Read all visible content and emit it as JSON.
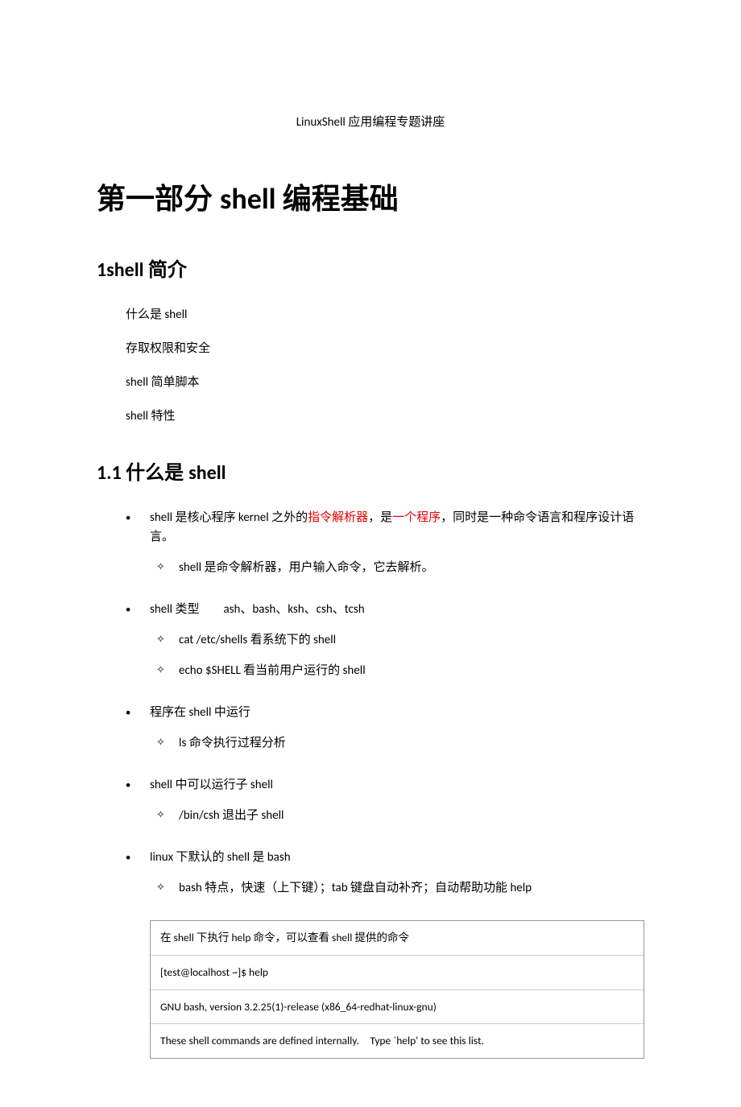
{
  "docTitle": "LinuxShell 应用编程专题讲座",
  "h1_pre": "第一部分 ",
  "h1_latin": "shell ",
  "h1_post": "编程基础",
  "section1": {
    "h2_pre": "1shell ",
    "h2_post": "简介",
    "items": [
      "什么是 shell",
      "存取权限和安全",
      "shell 简单脚本",
      "shell 特性"
    ]
  },
  "section11": {
    "h2_pre": "1.1 ",
    "h2_mid": "什么是 ",
    "h2_latin": "shell",
    "b0": {
      "t1": "shell 是核心程序 kernel 之外的",
      "r1": "指令解析器",
      "t2": "，是",
      "r2": "一个程序",
      "t3": "，同时是一种命令语言和程序设计语言。",
      "s1": "shell 是命令解析器，用户输入命令，它去解析。"
    },
    "b1": {
      "t": "shell 类型  ash、bash、ksh、csh、tcsh",
      "s1": "cat /etc/shells  看系统下的 shell",
      "s2": "echo $SHELL  看当前用户运行的 shell"
    },
    "b2": {
      "t": "程序在 shell 中运行",
      "s1": "ls 命令执行过程分析"
    },
    "b3": {
      "t": "shell 中可以运行子 shell",
      "s1": "/bin/csh  退出子 shell"
    },
    "b4": {
      "t": "linux 下默认的 shell 是 bash",
      "s1": "bash 特点，快速（上下键）；tab 键盘自动补齐；自动帮助功能 help"
    }
  },
  "codebox": {
    "r1": "在 shell 下执行 help 命令，可以查看 shell 提供的命令",
    "r2": "[test@localhost ~]$ help",
    "r3": "GNU bash, version 3.2.25(1)-release (x86_64-redhat-linux-gnu)",
    "r4": "These shell commands are defined internally. Type `help' to see this list."
  }
}
